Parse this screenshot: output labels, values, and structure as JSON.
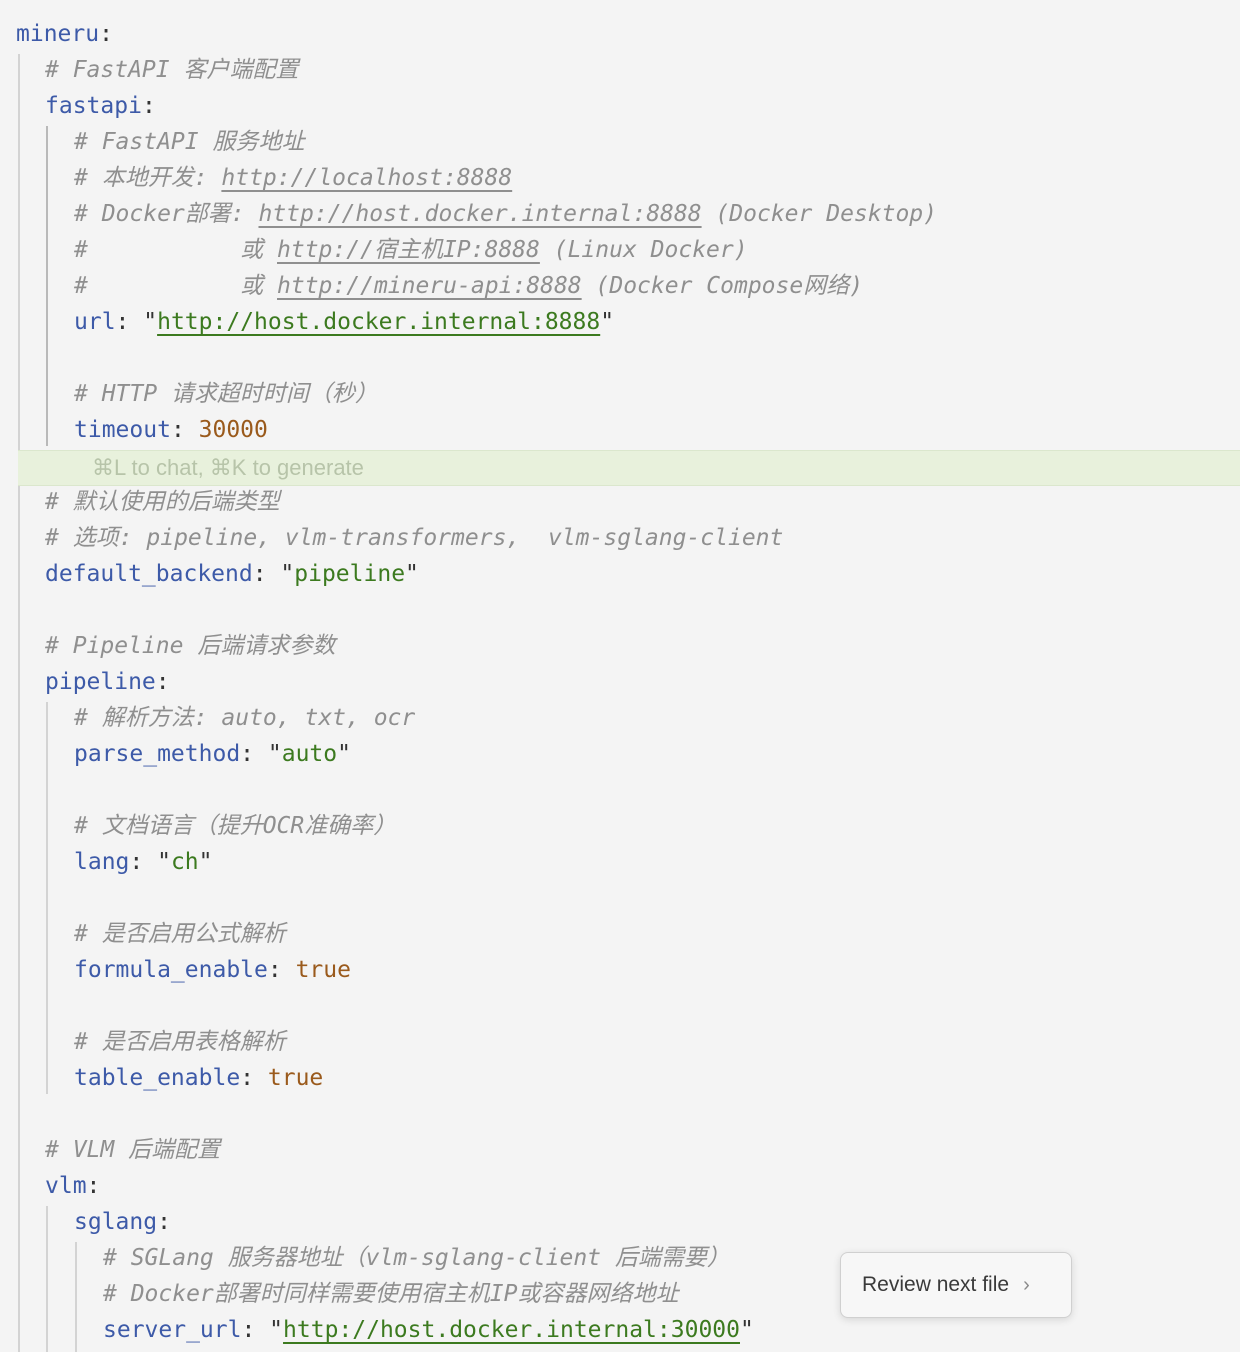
{
  "top_comment": "# ===========================================================",
  "lines": [
    {
      "indent": 0,
      "tokens": [
        {
          "t": "k",
          "v": "mineru"
        },
        {
          "t": "p",
          "v": ":"
        }
      ]
    },
    {
      "indent": 1,
      "tokens": [
        {
          "t": "c",
          "v": "# FastAPI 客户端配置"
        }
      ]
    },
    {
      "indent": 1,
      "tokens": [
        {
          "t": "k",
          "v": "fastapi"
        },
        {
          "t": "p",
          "v": ":"
        }
      ]
    },
    {
      "indent": 2,
      "tokens": [
        {
          "t": "c",
          "v": "# FastAPI 服务地址"
        }
      ]
    },
    {
      "indent": 2,
      "tokens": [
        {
          "t": "c",
          "v": "# 本地开发: "
        },
        {
          "t": "cu",
          "v": "http://localhost:8888"
        }
      ]
    },
    {
      "indent": 2,
      "tokens": [
        {
          "t": "c",
          "v": "# Docker部署: "
        },
        {
          "t": "cu",
          "v": "http://host.docker.internal:8888"
        },
        {
          "t": "c",
          "v": " (Docker Desktop)"
        }
      ]
    },
    {
      "indent": 2,
      "tokens": [
        {
          "t": "c",
          "v": "#           或 "
        },
        {
          "t": "cu",
          "v": "http://宿主机IP:8888"
        },
        {
          "t": "c",
          "v": " (Linux Docker)"
        }
      ]
    },
    {
      "indent": 2,
      "tokens": [
        {
          "t": "c",
          "v": "#           或 "
        },
        {
          "t": "cu",
          "v": "http://mineru-api:8888"
        },
        {
          "t": "c",
          "v": " (Docker Compose网络)"
        }
      ]
    },
    {
      "indent": 2,
      "tokens": [
        {
          "t": "k",
          "v": "url"
        },
        {
          "t": "p",
          "v": ": \""
        },
        {
          "t": "su",
          "v": "http://host.docker.internal:8888"
        },
        {
          "t": "p",
          "v": "\""
        }
      ]
    },
    {
      "indent": 2,
      "tokens": []
    },
    {
      "indent": 2,
      "tokens": [
        {
          "t": "c",
          "v": "# HTTP 请求超时时间（秒）"
        }
      ]
    },
    {
      "indent": 2,
      "tokens": [
        {
          "t": "k",
          "v": "timeout"
        },
        {
          "t": "p",
          "v": ": "
        },
        {
          "t": "n",
          "v": "30000"
        }
      ]
    },
    {
      "hint": true
    },
    {
      "indent": 1,
      "tokens": [
        {
          "t": "c",
          "v": "# 默认使用的后端类型"
        }
      ]
    },
    {
      "indent": 1,
      "tokens": [
        {
          "t": "c",
          "v": "# 选项: pipeline, vlm-transformers,  vlm-sglang-client"
        }
      ]
    },
    {
      "indent": 1,
      "tokens": [
        {
          "t": "k",
          "v": "default_backend"
        },
        {
          "t": "p",
          "v": ": \""
        },
        {
          "t": "s",
          "v": "pipeline"
        },
        {
          "t": "p",
          "v": "\""
        }
      ]
    },
    {
      "indent": 1,
      "tokens": []
    },
    {
      "indent": 1,
      "tokens": [
        {
          "t": "c",
          "v": "# Pipeline 后端请求参数"
        }
      ]
    },
    {
      "indent": 1,
      "tokens": [
        {
          "t": "k",
          "v": "pipeline"
        },
        {
          "t": "p",
          "v": ":"
        }
      ]
    },
    {
      "indent": 2,
      "tokens": [
        {
          "t": "c",
          "v": "# 解析方法: auto, txt, ocr"
        }
      ]
    },
    {
      "indent": 2,
      "tokens": [
        {
          "t": "k",
          "v": "parse_method"
        },
        {
          "t": "p",
          "v": ": \""
        },
        {
          "t": "s",
          "v": "auto"
        },
        {
          "t": "p",
          "v": "\""
        }
      ]
    },
    {
      "indent": 2,
      "tokens": []
    },
    {
      "indent": 2,
      "tokens": [
        {
          "t": "c",
          "v": "# 文档语言（提升OCR准确率）"
        }
      ]
    },
    {
      "indent": 2,
      "tokens": [
        {
          "t": "k",
          "v": "lang"
        },
        {
          "t": "p",
          "v": ": \""
        },
        {
          "t": "s",
          "v": "ch"
        },
        {
          "t": "p",
          "v": "\""
        }
      ]
    },
    {
      "indent": 2,
      "tokens": []
    },
    {
      "indent": 2,
      "tokens": [
        {
          "t": "c",
          "v": "# 是否启用公式解析"
        }
      ]
    },
    {
      "indent": 2,
      "tokens": [
        {
          "t": "k",
          "v": "formula_enable"
        },
        {
          "t": "p",
          "v": ": "
        },
        {
          "t": "n",
          "v": "true"
        }
      ]
    },
    {
      "indent": 2,
      "tokens": []
    },
    {
      "indent": 2,
      "tokens": [
        {
          "t": "c",
          "v": "# 是否启用表格解析"
        }
      ]
    },
    {
      "indent": 2,
      "tokens": [
        {
          "t": "k",
          "v": "table_enable"
        },
        {
          "t": "p",
          "v": ": "
        },
        {
          "t": "n",
          "v": "true"
        }
      ]
    },
    {
      "indent": 1,
      "tokens": []
    },
    {
      "indent": 1,
      "tokens": [
        {
          "t": "c",
          "v": "# VLM 后端配置"
        }
      ]
    },
    {
      "indent": 1,
      "tokens": [
        {
          "t": "k",
          "v": "vlm"
        },
        {
          "t": "p",
          "v": ":"
        }
      ]
    },
    {
      "indent": 2,
      "tokens": [
        {
          "t": "k",
          "v": "sglang"
        },
        {
          "t": "p",
          "v": ":"
        }
      ]
    },
    {
      "indent": 3,
      "tokens": [
        {
          "t": "c",
          "v": "# SGLang 服务器地址（vlm-sglang-client 后端需要）"
        }
      ]
    },
    {
      "indent": 3,
      "tokens": [
        {
          "t": "c",
          "v": "# Docker部署时同样需要使用宿主机IP或容器网络地址"
        }
      ]
    },
    {
      "indent": 3,
      "tokens": [
        {
          "t": "k",
          "v": "server_url"
        },
        {
          "t": "p",
          "v": ": \""
        },
        {
          "t": "su",
          "v": "http://host.docker.internal:30000"
        },
        {
          "t": "p",
          "v": "\""
        }
      ]
    }
  ],
  "inline_hint": "⌘L to chat, ⌘K to generate",
  "review_button": {
    "label": "Review next file",
    "icon": "chevron-right-icon"
  }
}
